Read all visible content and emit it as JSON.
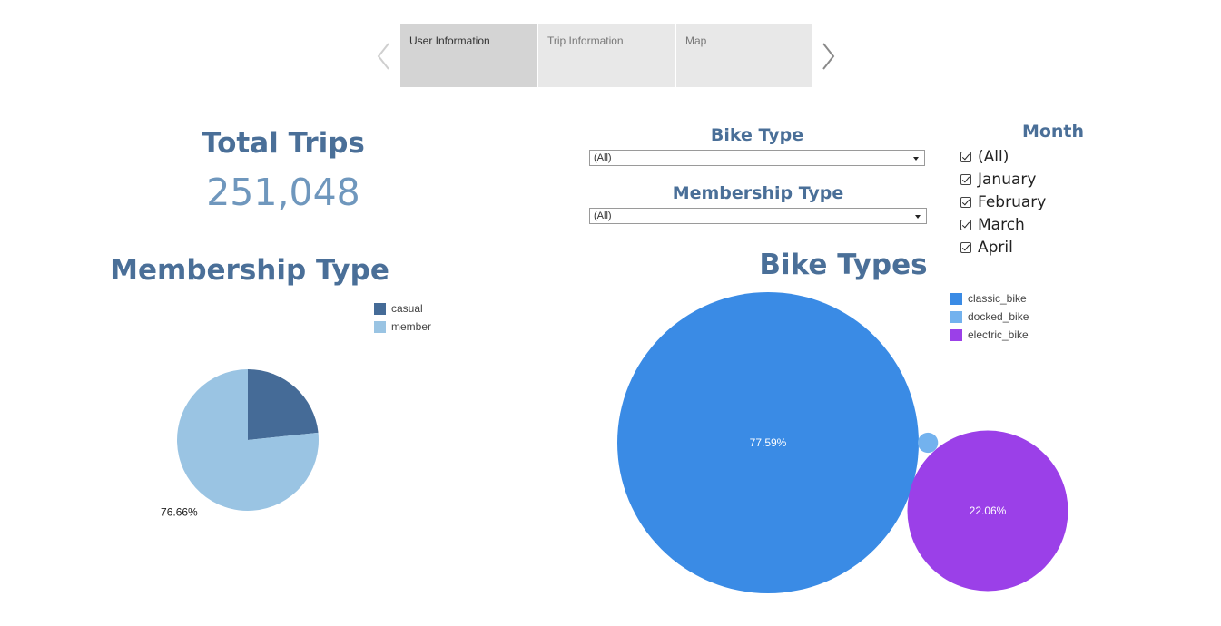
{
  "story_nav": {
    "tabs": [
      {
        "label": "User Information"
      },
      {
        "label": "Trip Information"
      },
      {
        "label": "Map"
      }
    ]
  },
  "kpi": {
    "title": "Total Trips",
    "value": "251,048"
  },
  "filters": {
    "bike_type": {
      "title": "Bike Type",
      "selected": "(All)"
    },
    "membership_type": {
      "title": "Membership Type",
      "selected": "(All)"
    },
    "month": {
      "title": "Month",
      "options": [
        {
          "label": "(All)",
          "checked": true
        },
        {
          "label": "January",
          "checked": true
        },
        {
          "label": "February",
          "checked": true
        },
        {
          "label": "March",
          "checked": true
        },
        {
          "label": "April",
          "checked": true
        }
      ]
    }
  },
  "membership_chart": {
    "title": "Membership Type",
    "legend": [
      {
        "label": "casual",
        "color": "#456b97"
      },
      {
        "label": "member",
        "color": "#9ac4e3"
      }
    ]
  },
  "bike_chart": {
    "title": "Bike Types",
    "legend": [
      {
        "label": "classic_bike",
        "color": "#3a8be5"
      },
      {
        "label": "docked_bike",
        "color": "#73b2ee"
      },
      {
        "label": "electric_bike",
        "color": "#9b40e8"
      }
    ]
  },
  "chart_data": [
    {
      "type": "pie",
      "title": "Membership Type",
      "categories": [
        "casual",
        "member"
      ],
      "values": [
        23.34,
        76.66
      ],
      "labels": [
        "23.34%",
        "76.66%"
      ],
      "colors": [
        "#456b97",
        "#9ac4e3"
      ],
      "legend_position": "top-right"
    },
    {
      "type": "bubble",
      "title": "Bike Types",
      "categories": [
        "classic_bike",
        "docked_bike",
        "electric_bike"
      ],
      "values": [
        77.59,
        0.35,
        22.06
      ],
      "labels": [
        "77.59%",
        "",
        "22.06%"
      ],
      "colors": [
        "#3a8be5",
        "#73b2ee",
        "#9b40e8"
      ],
      "legend_position": "top-right"
    }
  ]
}
